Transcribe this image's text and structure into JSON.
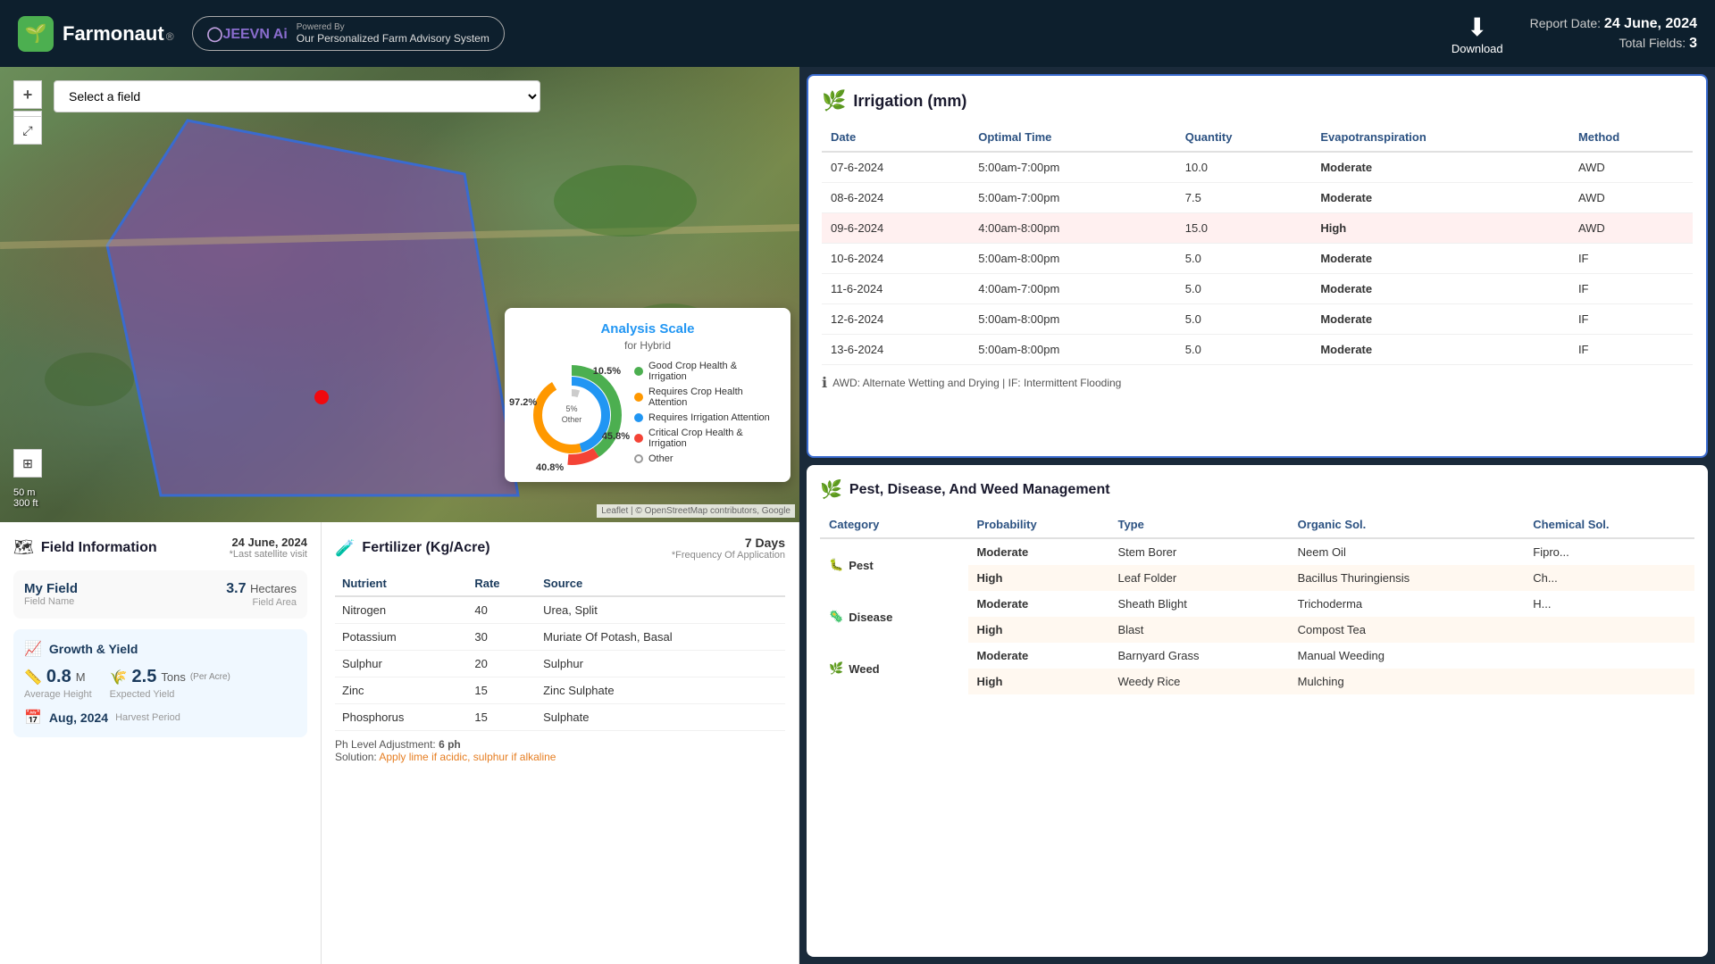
{
  "header": {
    "logo_text": "Farmonaut",
    "logo_reg": "®",
    "jeevn_label": "JEEVN Ai",
    "powered_by": "Powered By",
    "advisory_text": "Our Personalized Farm Advisory System",
    "download_label": "Download",
    "report_date_label": "Report Date:",
    "report_date_value": "24 June, 2024",
    "total_fields_label": "Total Fields:",
    "total_fields_value": "3"
  },
  "map": {
    "select_placeholder": "Select a field",
    "zoom_in": "+",
    "zoom_out": "−",
    "scale_m": "50 m",
    "scale_ft": "300 ft",
    "attribution": "Leaflet | © OpenStreetMap contributors, Google"
  },
  "analysis_scale": {
    "title": "Analysis Scale",
    "subtitle": "for Hybrid",
    "label_97": "97.2%",
    "label_10": "10.5%",
    "label_45": "45.8%",
    "label_40": "40.8%",
    "center_label": "5%\nOther",
    "legend": [
      {
        "color": "#4CAF50",
        "label": "Good Crop Health & Irrigation"
      },
      {
        "color": "#FF9800",
        "label": "Requires Crop Health Attention"
      },
      {
        "color": "#2196F3",
        "label": "Requires Irrigation Attention"
      },
      {
        "color": "#F44336",
        "label": "Critical Crop Health & Irrigation"
      },
      {
        "color": "",
        "label": "Other"
      }
    ]
  },
  "field_info": {
    "title": "Field Information",
    "date": "24 June, 2024",
    "last_satellite": "*Last satellite visit",
    "field_name_val": "My Field",
    "field_name_label": "Field Name",
    "field_area_val": "3.7",
    "field_area_unit": "Hectares",
    "field_area_label": "Field Area"
  },
  "growth": {
    "title": "Growth & Yield",
    "height_val": "0.8",
    "height_unit": "M",
    "height_label": "Average Height",
    "yield_val": "2.5",
    "yield_unit": "Tons",
    "yield_per": "(Per Acre)",
    "yield_label": "Expected Yield",
    "harvest_val": "Aug, 2024",
    "harvest_label": "Harvest Period"
  },
  "fertilizer": {
    "title": "Fertilizer (Kg/Acre)",
    "freq_label": "7 Days",
    "freq_sub": "*Frequency Of Application",
    "col_nutrient": "Nutrient",
    "col_rate": "Rate",
    "col_source": "Source",
    "rows": [
      {
        "nutrient": "Nitrogen",
        "rate": "40",
        "source": "Urea, Split"
      },
      {
        "nutrient": "Potassium",
        "rate": "30",
        "source": "Muriate Of Potash, Basal"
      },
      {
        "nutrient": "Sulphur",
        "rate": "20",
        "source": "Sulphur"
      },
      {
        "nutrient": "Zinc",
        "rate": "15",
        "source": "Zinc Sulphate"
      },
      {
        "nutrient": "Phosphorus",
        "rate": "15",
        "source": "Sulphate"
      }
    ],
    "ph_label": "Ph Level Adjustment:",
    "ph_val": "6 ph",
    "solution_label": "Solution:",
    "solution_text": "Apply lime if acidic, sulphur if alkaline"
  },
  "irrigation": {
    "title": "Irrigation (mm)",
    "col_date": "Date",
    "col_optimal": "Optimal Time",
    "col_quantity": "Quantity",
    "col_evap": "Evapotranspiration",
    "col_method": "Method",
    "rows": [
      {
        "date": "07-6-2024",
        "optimal": "5:00am-7:00pm",
        "quantity": "10.0",
        "evap": "Moderate",
        "evap_class": "moderate",
        "method": "AWD",
        "highlight": false
      },
      {
        "date": "08-6-2024",
        "optimal": "5:00am-7:00pm",
        "quantity": "7.5",
        "evap": "Moderate",
        "evap_class": "moderate",
        "method": "AWD",
        "highlight": false
      },
      {
        "date": "09-6-2024",
        "optimal": "4:00am-8:00pm",
        "quantity": "15.0",
        "evap": "High",
        "evap_class": "high",
        "method": "AWD",
        "highlight": true
      },
      {
        "date": "10-6-2024",
        "optimal": "5:00am-8:00pm",
        "quantity": "5.0",
        "evap": "Moderate",
        "evap_class": "moderate",
        "method": "IF",
        "highlight": false
      },
      {
        "date": "11-6-2024",
        "optimal": "4:00am-7:00pm",
        "quantity": "5.0",
        "evap": "Moderate",
        "evap_class": "moderate",
        "method": "IF",
        "highlight": false
      },
      {
        "date": "12-6-2024",
        "optimal": "5:00am-8:00pm",
        "quantity": "5.0",
        "evap": "Moderate",
        "evap_class": "moderate",
        "method": "IF",
        "highlight": false
      },
      {
        "date": "13-6-2024",
        "optimal": "5:00am-8:00pm",
        "quantity": "5.0",
        "evap": "Moderate",
        "evap_class": "moderate",
        "method": "IF",
        "highlight": false
      }
    ],
    "footnote": "AWD: Alternate Wetting and Drying | IF: Intermittent Flooding"
  },
  "pest": {
    "title": "Pest, Disease, And Weed Management",
    "col_category": "Category",
    "col_probability": "Probability",
    "col_type": "Type",
    "col_organic": "Organic Sol.",
    "col_chemical": "Chemical Sol.",
    "sections": [
      {
        "category": "Pest",
        "icon": "🐛",
        "rows": [
          {
            "probability": "Moderate",
            "prob_class": "moderate",
            "type": "Stem Borer",
            "organic": "Neem Oil",
            "chemical": "Fipro...",
            "highlight": false
          },
          {
            "probability": "High",
            "prob_class": "high",
            "type": "Leaf Folder",
            "organic": "Bacillus Thuringiensis",
            "chemical": "Ch...",
            "highlight": true
          }
        ]
      },
      {
        "category": "Disease",
        "icon": "🦠",
        "rows": [
          {
            "probability": "Moderate",
            "prob_class": "moderate",
            "type": "Sheath Blight",
            "organic": "Trichoderma",
            "chemical": "H...",
            "highlight": false
          },
          {
            "probability": "High",
            "prob_class": "high",
            "type": "Blast",
            "organic": "Compost Tea",
            "chemical": "",
            "highlight": true
          }
        ]
      },
      {
        "category": "Weed",
        "icon": "🌿",
        "rows": [
          {
            "probability": "Moderate",
            "prob_class": "moderate",
            "type": "Barnyard Grass",
            "organic": "Manual Weeding",
            "chemical": "",
            "highlight": false
          },
          {
            "probability": "High",
            "prob_class": "high",
            "type": "Weedy Rice",
            "organic": "Mulching",
            "chemical": "",
            "highlight": true
          }
        ]
      }
    ]
  }
}
